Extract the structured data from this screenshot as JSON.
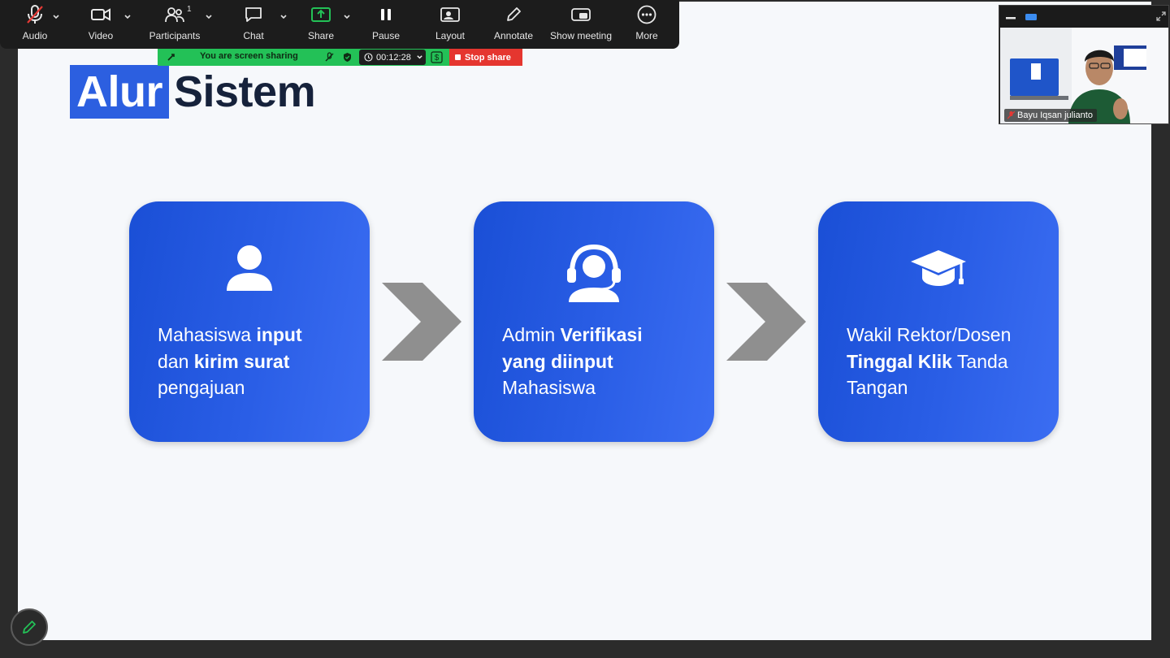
{
  "toolbar": {
    "audio": "Audio",
    "video": "Video",
    "participants": "Participants",
    "participants_count": "1",
    "chat": "Chat",
    "share": "Share",
    "pause": "Pause",
    "layout": "Layout",
    "annotate": "Annotate",
    "show_meeting": "Show meeting",
    "more": "More"
  },
  "sharing": {
    "status": "You are screen sharing",
    "timer": "00:12:28",
    "stop": "Stop share"
  },
  "slide": {
    "title_highlight": "Alur",
    "title_rest": "Sistem",
    "steps": [
      {
        "parts": [
          [
            "Mahasiswa ",
            false
          ],
          [
            "input",
            true
          ],
          [
            "dan ",
            false
          ],
          [
            "kirim surat",
            true
          ],
          [
            "pengajuan",
            false
          ]
        ]
      },
      {
        "parts": [
          [
            "Admin ",
            false
          ],
          [
            "Verifikasi",
            true
          ],
          [
            "yang diinput",
            true
          ],
          [
            "Mahasiswa",
            false
          ]
        ]
      },
      {
        "parts": [
          [
            "Wakil Rektor/Dosen",
            false
          ],
          [
            "Tinggal Klik",
            true
          ],
          [
            " Tanda",
            false
          ],
          [
            "Tangan",
            false
          ]
        ]
      }
    ]
  },
  "video": {
    "participant_name": "Bayu Iqsan julianto"
  },
  "colors": {
    "card": "#2a5ee6",
    "title_highlight": "#2c5fe0",
    "share_green": "#23c157",
    "stop_red": "#e5362f"
  }
}
